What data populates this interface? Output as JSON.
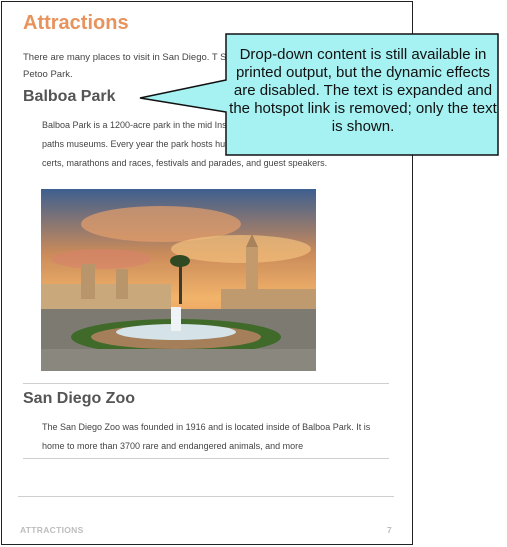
{
  "page": {
    "title": "Attractions",
    "intro": "There are many places to visit in San Diego. T San Diego Zoo, and Petoo Park.",
    "sections": [
      {
        "heading": "Balboa Park",
        "text": "Balboa Park is a 1200-acre park in the mid Inside the park are gardens, walking paths museums. Every year the park hosts hundreds of events, including con certs, marathons and races, festivals and parades, and guest speakers."
      },
      {
        "heading": "San Diego Zoo",
        "text": "The San Diego Zoo was founded in 1916 and is located inside of Balboa Park. It is home to more than 3700 rare and endangered animals, and more"
      }
    ],
    "footer": {
      "label": "ATTRACTIONS",
      "page_number": "7"
    }
  },
  "callout": {
    "text": "Drop-down content is still available in printed output, but the dynamic effects are disabled. The text is expanded and the hotspot link is removed; only the text is shown."
  }
}
